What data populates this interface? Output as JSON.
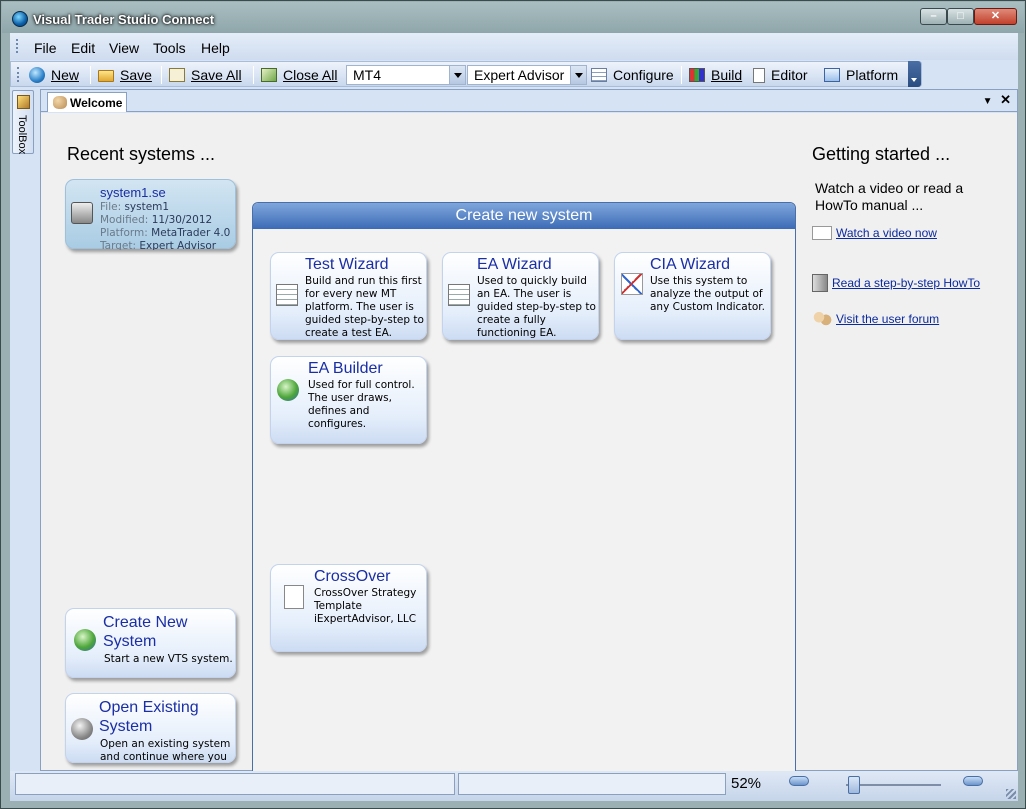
{
  "window": {
    "title": "Visual Trader Studio Connect"
  },
  "menu": [
    "File",
    "Edit",
    "View",
    "Tools",
    "Help"
  ],
  "toolbar": {
    "new_label": "New",
    "save_label": "Save",
    "save_all_label": "Save All",
    "close_all_label": "Close All",
    "platform_select": "MT4",
    "target_select": "Expert Advisor",
    "configure_label": "Configure",
    "build_label": "Build",
    "editor_label": "Editor",
    "platform_label": "Platform"
  },
  "toolbox": {
    "label": "ToolBox"
  },
  "doc_tab": {
    "label": "Welcome"
  },
  "recent": {
    "heading": "Recent systems ...",
    "items": [
      {
        "name": "system1.se",
        "file_label": "File:",
        "file": "system1",
        "modified_label": "Modified:",
        "modified": "11/30/2012",
        "platform_label": "Platform:",
        "platform": "MetaTrader 4.0",
        "target_label": "Target:",
        "target": "Expert Advisor"
      }
    ]
  },
  "actions": {
    "create": {
      "title_1": "Create New",
      "title_2": "System",
      "desc": "Start a new VTS system."
    },
    "open": {
      "title_1": "Open Existing",
      "title_2": "System",
      "desc_1": "Open an existing system",
      "desc_2": "and continue where you"
    }
  },
  "create_panel": {
    "header": "Create new system",
    "cards": [
      {
        "title": "Test Wizard",
        "lines": [
          "Build and run this first",
          "for every new MT",
          "platform. The user is",
          "guided step-by-step to",
          "create  a test EA."
        ]
      },
      {
        "title": "EA Wizard",
        "lines": [
          "Used to quickly build",
          "an EA. The user is",
          "guided step-by-step to",
          "create  a fully",
          "functioning EA."
        ]
      },
      {
        "title": "CIA Wizard",
        "lines": [
          "Use this system to",
          "analyze the output of",
          "any Custom Indicator."
        ]
      },
      {
        "title": "EA Builder",
        "lines": [
          "Used for full control.",
          "The user draws,",
          "defines and configures."
        ]
      },
      {
        "title": "CrossOver",
        "lines": [
          "CrossOver Strategy",
          "Template",
          "iExpertAdvisor, LLC"
        ]
      }
    ]
  },
  "getting_started": {
    "heading": "Getting started ...",
    "intro_1": "Watch a video or read a",
    "intro_2": "HowTo manual ...",
    "links": [
      "Watch a video now",
      "Read a step-by-step HowTo",
      "Visit the user forum"
    ]
  },
  "status": {
    "zoom": "52%"
  }
}
